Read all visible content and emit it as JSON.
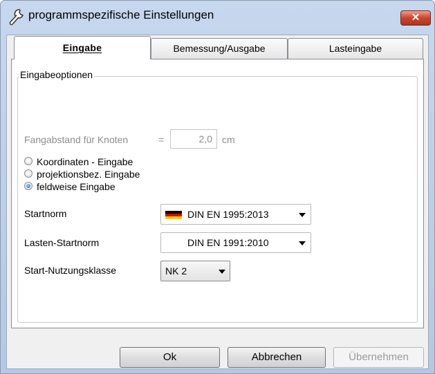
{
  "window": {
    "title": "programmspezifische Einstellungen",
    "close_label": "✕"
  },
  "tabs": [
    {
      "label": "Eingabe",
      "active": true
    },
    {
      "label": "Bemessung/Ausgabe",
      "active": false
    },
    {
      "label": "Lasteingabe",
      "active": false
    }
  ],
  "group": {
    "label": "Eingabeoptionen",
    "snap_label": "Fangabstand für Knoten",
    "snap_equals": "=",
    "snap_value": "2,0",
    "snap_unit": "cm"
  },
  "input_mode": {
    "options": [
      {
        "label": "Koordinaten - Eingabe",
        "checked": false
      },
      {
        "label": "projektionsbez. Eingabe",
        "checked": false
      },
      {
        "label": "feldweise Eingabe",
        "checked": true
      }
    ]
  },
  "settings": {
    "startnorm_label": "Startnorm",
    "startnorm_value": "DIN EN 1995:2013",
    "lasten_label": "Lasten-Startnorm",
    "lasten_value": "DIN EN 1991:2010",
    "nutzung_label": "Start-Nutzungsklasse",
    "nutzung_value": "NK 2"
  },
  "buttons": {
    "ok": "Ok",
    "cancel": "Abbrechen",
    "apply": "Übernehmen"
  },
  "colors": {
    "flag_black": "#000000",
    "flag_red": "#dd0000",
    "flag_gold": "#ffce00",
    "radio_accent": "#1f66c9"
  }
}
